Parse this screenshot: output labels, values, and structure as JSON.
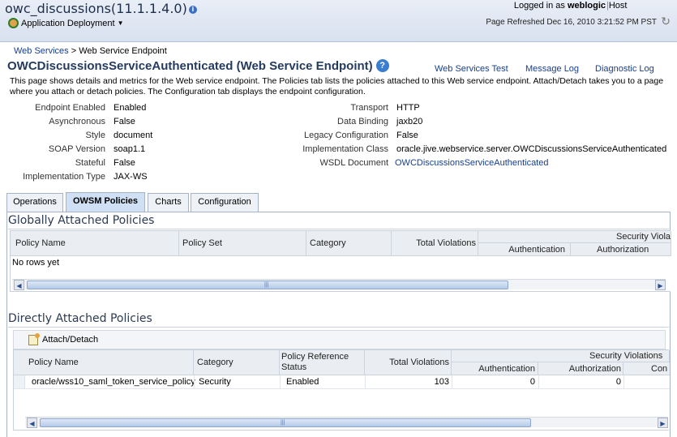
{
  "header": {
    "app_title": "owc_discussions(11.1.1.4.0)",
    "menu_label": "Application Deployment",
    "logged_in_prefix": "Logged in as",
    "username": "weblogic",
    "host_label": "Host",
    "refreshed": "Page Refreshed Dec 16, 2010 3:21:52 PM PST"
  },
  "breadcrumb": {
    "parent": "Web Services",
    "separator": ">",
    "current": "Web Service Endpoint"
  },
  "page": {
    "title": "OWCDiscussionsServiceAuthenticated (Web Service Endpoint)",
    "links": [
      "Web Services Test",
      "Message Log",
      "Diagnostic Log"
    ],
    "description": "This page shows details and metrics for the Web service endpoint. The Policies tab lists the policies attached to this Web service endpoint. Attach/Detach takes you to a page where you attach or detach policies. The Configuration tab displays the endpoint configuration."
  },
  "left_props": [
    {
      "label": "Endpoint Enabled",
      "value": "Enabled"
    },
    {
      "label": "Asynchronous",
      "value": "False"
    },
    {
      "label": "Style",
      "value": "document"
    },
    {
      "label": "SOAP Version",
      "value": "soap1.1"
    },
    {
      "label": "Stateful",
      "value": "False"
    },
    {
      "label": "Implementation Type",
      "value": "JAX-WS"
    }
  ],
  "right_props": [
    {
      "label": "Transport",
      "value": "HTTP"
    },
    {
      "label": "Data Binding",
      "value": "jaxb20"
    },
    {
      "label": "Legacy Configuration",
      "value": "False"
    },
    {
      "label": "Implementation Class",
      "value": "oracle.jive.webservice.server.OWCDiscussionsServiceAuthenticated"
    },
    {
      "label": "WSDL Document",
      "value": "OWCDiscussionsServiceAuthenticated"
    }
  ],
  "tabs": [
    "Operations",
    "OWSM Policies",
    "Charts",
    "Configuration"
  ],
  "active_tab": "OWSM Policies",
  "global_policies": {
    "title": "Globally Attached Policies",
    "columns": [
      "Policy Name",
      "Policy Set",
      "Category",
      "Total Violations"
    ],
    "group_header": "Security Violations",
    "group_header_truncated": "Security Viola",
    "subcolumns": [
      "Authentication",
      "Authorization"
    ],
    "empty_text": "No rows yet"
  },
  "direct_policies": {
    "title": "Directly Attached Policies",
    "attach_button": "Attach/Detach",
    "columns": [
      "Policy Name",
      "Category",
      "Policy Reference Status",
      "Total Violations"
    ],
    "group_header": "Security Violations",
    "subcolumns": [
      "Authentication",
      "Authorization",
      "Con"
    ],
    "rows": [
      {
        "policy_name": "oracle/wss10_saml_token_service_policy",
        "category": "Security",
        "status": "Enabled",
        "total": "103",
        "authentication": "0",
        "authorization": "0"
      }
    ]
  }
}
